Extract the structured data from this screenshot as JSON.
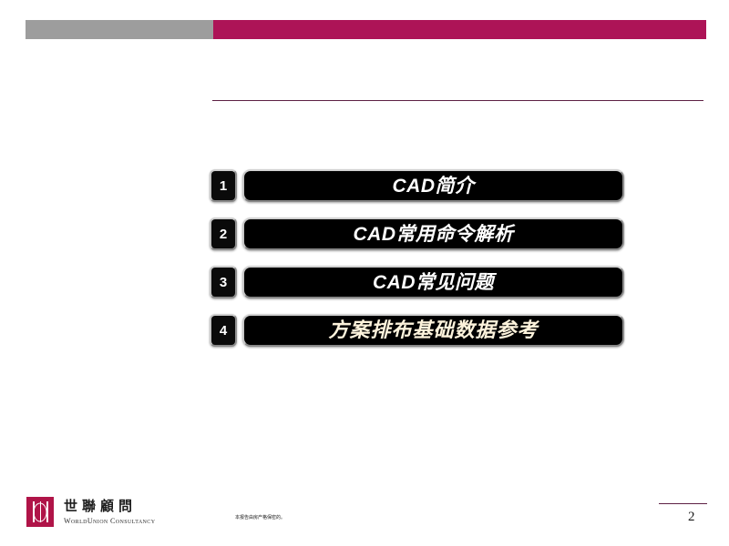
{
  "slide": {
    "page_number": "2",
    "confidential_note": "本报告由房产格保密的。"
  },
  "topbar": {
    "gray_color": "#9d9d9d",
    "magenta_color": "#ad1457"
  },
  "header": {
    "rule_color": "#5d2044"
  },
  "agenda": {
    "items": [
      {
        "number": "1",
        "label": "CAD简介",
        "style": "bold-italic",
        "text_color": "#ffffff"
      },
      {
        "number": "2",
        "label": "CAD常用命令解析",
        "style": "bold-italic",
        "text_color": "#ffffff"
      },
      {
        "number": "3",
        "label": "CAD常见问题",
        "style": "bold-italic",
        "text_color": "#ffffff"
      },
      {
        "number": "4",
        "label": "方案排布基础数据参考",
        "style": "script",
        "text_color": "#fdf3dc"
      }
    ]
  },
  "logo": {
    "mark_color": "#b01448",
    "name_cn": "世聯顧問",
    "name_en": "WorldUnion Consultancy"
  }
}
